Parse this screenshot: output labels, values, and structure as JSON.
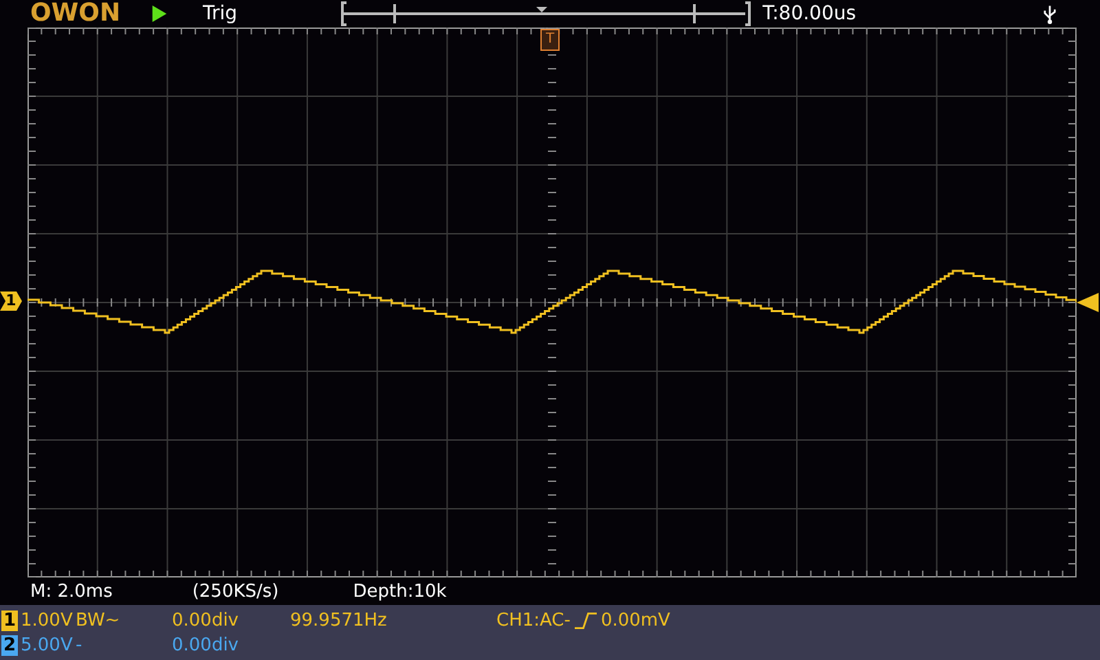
{
  "header": {
    "brand": "OWON",
    "running": true,
    "trigger_status": "Trig",
    "trigger_time": "T:80.00us"
  },
  "screen": {
    "trigger_marker": "T",
    "channel_marker": "1"
  },
  "acquisition": {
    "timebase": "M: 2.0ms",
    "sample_rate": "(250KS/s)",
    "depth": "Depth:10k"
  },
  "channels": [
    {
      "number": "1",
      "scale": "1.00V",
      "coupling": "BW~",
      "offset": "0.00div",
      "frequency": "99.9571Hz",
      "trigger": {
        "source": "CH1:AC-",
        "level": "0.00mV"
      },
      "color": "#f0c020"
    },
    {
      "number": "2",
      "scale": "5.00V",
      "coupling": "-",
      "offset": "0.00div",
      "color": "#4aa8f0"
    }
  ]
}
